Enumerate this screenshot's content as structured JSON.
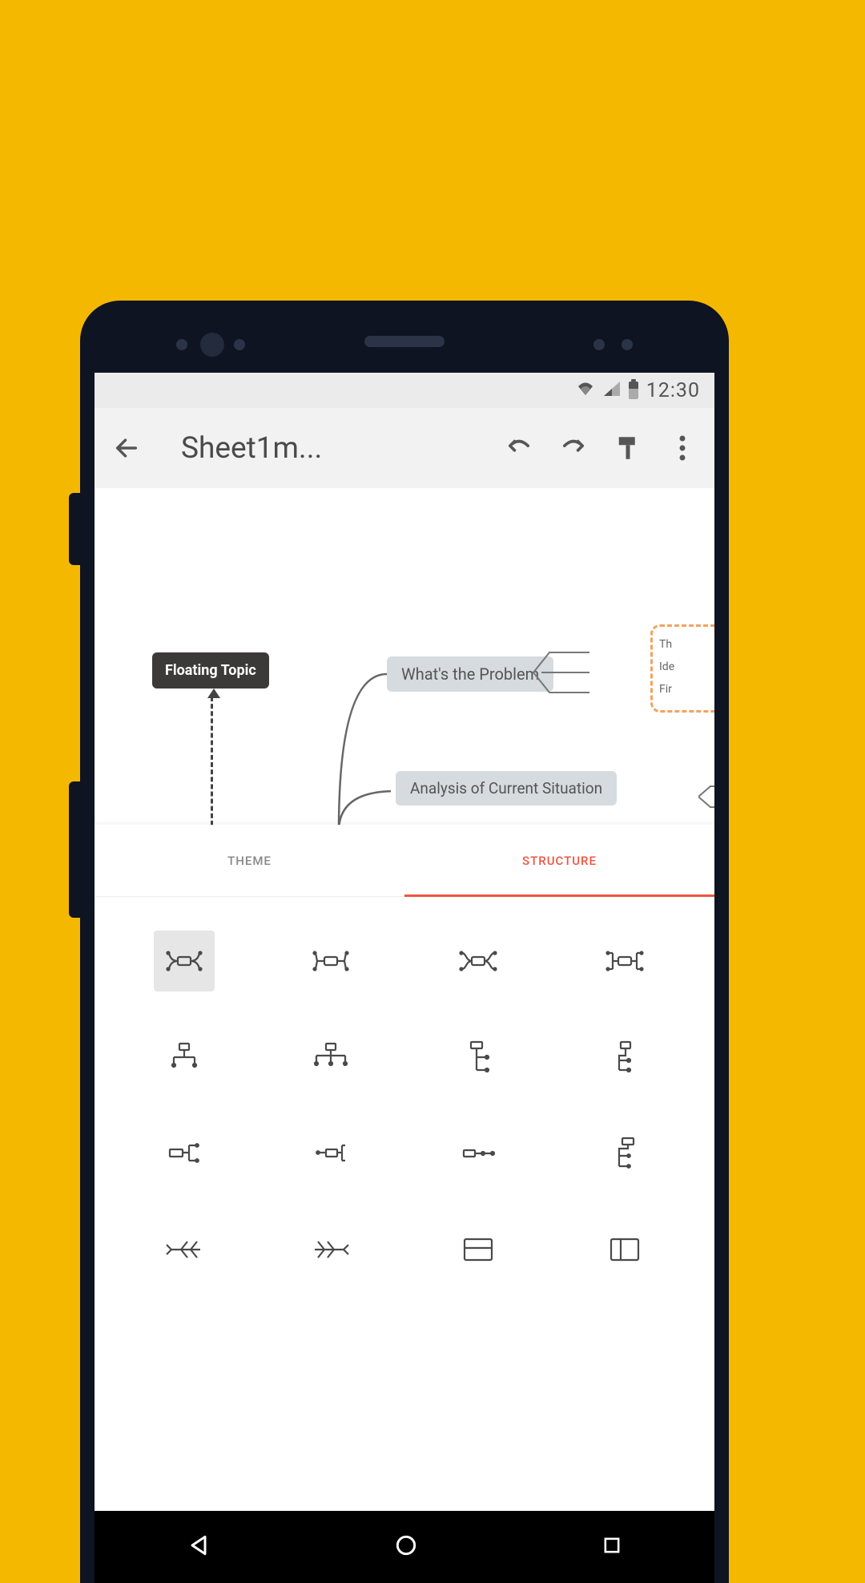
{
  "statusbar": {
    "time": "12:30"
  },
  "toolbar": {
    "title": "Sheet1m..."
  },
  "canvas": {
    "floating_topic": "Floating Topic",
    "node1": "What's the Problem",
    "node2": "Analysis of Current Situation",
    "sub1": "Th",
    "sub2": "Ide",
    "sub3": "Fir"
  },
  "tabs": {
    "theme": "THEME",
    "structure": "STRUCTURE"
  },
  "structure_icons": [
    "mindmap-balanced-1",
    "mindmap-balanced-2",
    "mindmap-balanced-3",
    "mindmap-balanced-4",
    "org-chart-down-1",
    "org-chart-down-2",
    "logic-right-1",
    "logic-right-2",
    "tree-right-1",
    "tree-right-2",
    "tree-right-3",
    "tree-right-4",
    "fishbone-left",
    "fishbone-right",
    "spreadsheet-row",
    "spreadsheet-col"
  ]
}
